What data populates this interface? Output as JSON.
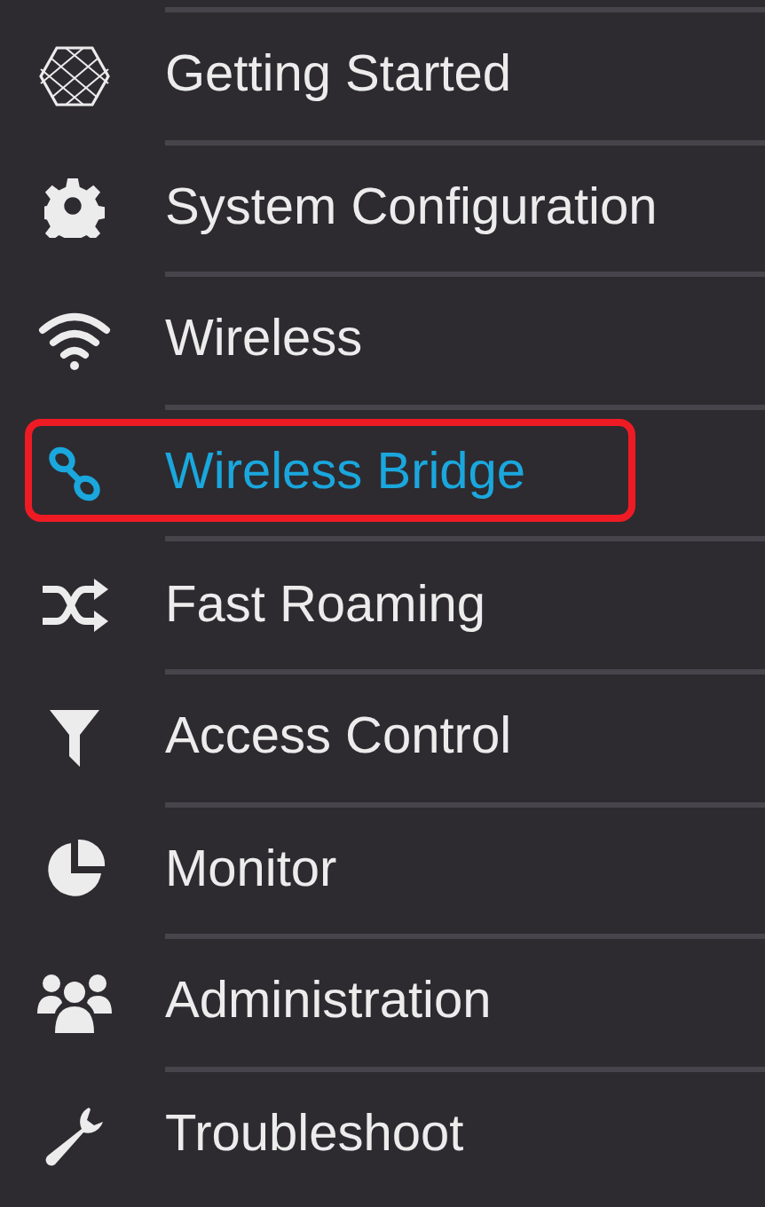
{
  "menu": [
    {
      "label": "Getting Started",
      "kind": "hexagon",
      "selected": false,
      "annotated": false
    },
    {
      "label": "System Configuration",
      "kind": "gear",
      "selected": false,
      "annotated": false
    },
    {
      "label": "Wireless",
      "kind": "wifi",
      "selected": false,
      "annotated": false
    },
    {
      "label": "Wireless Bridge",
      "kind": "link",
      "selected": true,
      "annotated": true
    },
    {
      "label": "Fast Roaming",
      "kind": "shuffle",
      "selected": false,
      "annotated": false
    },
    {
      "label": "Access Control",
      "kind": "funnel",
      "selected": false,
      "annotated": false
    },
    {
      "label": "Monitor",
      "kind": "pie",
      "selected": false,
      "annotated": false
    },
    {
      "label": "Administration",
      "kind": "people",
      "selected": false,
      "annotated": false
    },
    {
      "label": "Troubleshoot",
      "kind": "wrench",
      "selected": false,
      "annotated": false
    }
  ]
}
